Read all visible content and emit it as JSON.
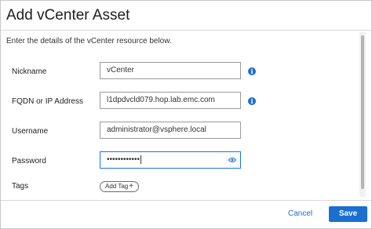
{
  "dialog": {
    "title": "Add vCenter Asset",
    "intro": "Enter the details of the vCenter resource below."
  },
  "fields": {
    "nickname": {
      "label": "Nickname",
      "value": "vCenter"
    },
    "fqdn": {
      "label": "FQDN or IP Address",
      "value": "l1dpdvcld079.hop.lab.emc.com"
    },
    "username": {
      "label": "Username",
      "value": "administrator@vsphere.local"
    },
    "password": {
      "label": "Password",
      "value": "••••••••••••"
    },
    "tags": {
      "label": "Tags",
      "button": "Add Tag",
      "button_icon": "+"
    }
  },
  "footer": {
    "cancel": "Cancel",
    "save": "Save"
  },
  "icons": {
    "info": "info-icon",
    "eye": "eye-icon"
  },
  "colors": {
    "accent": "#1a6fd1"
  }
}
